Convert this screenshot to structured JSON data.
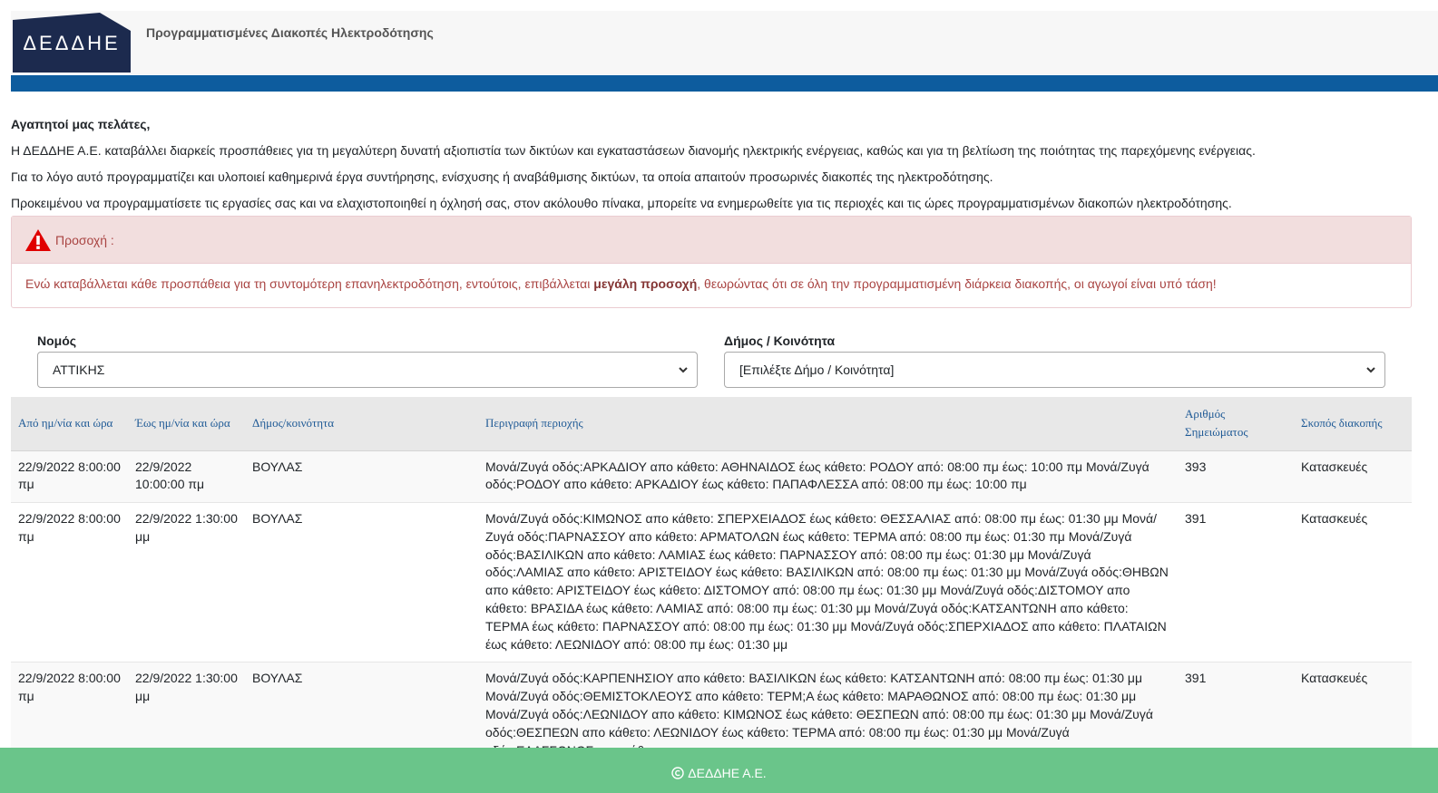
{
  "header": {
    "logo_text": "ΔΕΔΔΗΕ",
    "title": "Προγραμματισμένες Διακοπές Ηλεκτροδότησης",
    "brand_color": "#1c2a4e",
    "bar_color": "#0d5c9e"
  },
  "intro": {
    "greeting": "Αγαπητοί μας πελάτες,",
    "p1": "Η ΔΕΔΔΗΕ Α.Ε. καταβάλλει διαρκείς προσπάθειες για τη μεγαλύτερη δυνατή αξιοπιστία των δικτύων και εγκαταστάσεων διανομής ηλεκτρικής ενέργειας, καθώς και για τη βελτίωση της ποιότητας της παρεχόμενης ενέργειας.",
    "p2": "Για το λόγο αυτό προγραμματίζει και υλοποιεί καθημερινά έργα συντήρησης, ενίσχυσης ή αναβάθμισης δικτύων, τα οποία απαιτούν προσωρινές διακοπές της ηλεκτροδότησης.",
    "p3": "Προκειμένου να προγραμματίσετε τις εργασίες σας και να ελαχιστοποιηθεί η όχλησή σας, στον ακόλουθο πίνακα, μπορείτε να ενημερωθείτε για τις περιοχές και τις ώρες προγραμματισμένων διακοπών ηλεκτροδότησης."
  },
  "alert": {
    "icon": "warning-triangle-icon",
    "title": "Προσοχή :",
    "text_before": "Ενώ καταβάλλεται κάθε προσπάθεια για τη συντομότερη επανηλεκτροδότηση, εντούτοις, επιβάλλεται ",
    "text_bold": "μεγάλη προσοχή",
    "text_after": ", θεωρώντας ότι σε όλη την προγραμματισμένη διάρκεια διακοπής, οι αγωγοί είναι υπό τάση!"
  },
  "filters": {
    "prefecture_label": "Νομός",
    "prefecture_value": "ΑΤΤΙΚΗΣ",
    "municipality_label": "Δήμος / Κοινότητα",
    "municipality_value": "[Επιλέξτε Δήμο / Κοινότητα]"
  },
  "table": {
    "headers": {
      "from": "Από ημ/νία και ώρα",
      "to": "Έως ημ/νία και ώρα",
      "municipality": "Δήμος/κοινότητα",
      "area": "Περιγραφή περιοχής",
      "note_no": "Αριθμός Σημειώματος",
      "purpose": "Σκοπός διακοπής"
    },
    "rows": [
      {
        "from": "22/9/2022 8:00:00 πμ",
        "to": "22/9/2022 10:00:00 πμ",
        "municipality": "ΒΟΥΛΑΣ",
        "area": "Μονά/Ζυγά οδός:ΑΡΚΑΔΙΟΥ απο κάθετο: ΑΘΗΝΑΙΔΟΣ έως κάθετο: ΡΟΔΟΥ από: 08:00 πμ έως: 10:00 πμ Μονά/Ζυγά οδός:ΡΟΔΟΥ απο κάθετο: ΑΡΚΑΔΙΟΥ έως κάθετο: ΠΑΠΑΦΛΕΣΣΑ από: 08:00 πμ έως: 10:00 πμ",
        "note_no": "393",
        "purpose": "Κατασκευές"
      },
      {
        "from": "22/9/2022 8:00:00 πμ",
        "to": "22/9/2022 1:30:00 μμ",
        "municipality": "ΒΟΥΛΑΣ",
        "area": "Μονά/Ζυγά οδός:ΚΙΜΩΝΟΣ απο κάθετο: ΣΠΕΡΧΕΙΑΔΟΣ έως κάθετο: ΘΕΣΣΑΛΙΑΣ από: 08:00 πμ έως: 01:30 μμ Μονά/Ζυγά οδός:ΠΑΡΝΑΣΣΟΥ απο κάθετο: ΑΡΜΑΤΟΛΩΝ έως κάθετο: ΤΕΡΜΑ από: 08:00 πμ έως: 01:30 πμ Μονά/Ζυγά οδός:ΒΑΣΙΛΙΚΩΝ απο κάθετο: ΛΑΜΙΑΣ έως κάθετο: ΠΑΡΝΑΣΣΟΥ από: 08:00 πμ έως: 01:30 μμ Μονά/Ζυγά οδός:ΛΑΜΙΑΣ απο κάθετο: ΑΡΙΣΤΕΙΔΟΥ έως κάθετο: ΒΑΣΙΛΙΚΩΝ από: 08:00 πμ έως: 01:30 μμ Μονά/Ζυγά οδός:ΘΗΒΩΝ απο κάθετο: ΑΡΙΣΤΕΙΔΟΥ έως κάθετο: ΔΙΣΤΟΜΟΥ από: 08:00 πμ έως: 01:30 μμ Μονά/Ζυγά οδός:ΔΙΣΤΟΜΟΥ απο κάθετο: ΒΡΑΣΙΔΑ έως κάθετο: ΛΑΜΙΑΣ από: 08:00 πμ έως: 01:30 μμ Μονά/Ζυγά οδός:ΚΑΤΣΑΝΤΩΝΗ απο κάθετο: ΤΕΡΜΑ έως κάθετο: ΠΑΡΝΑΣΣΟΥ από: 08:00 πμ έως: 01:30 μμ Μονά/Ζυγά οδός:ΣΠΕΡΧΙΑΔΟΣ απο κάθετο: ΠΛΑΤΑΙΩΝ έως κάθετο: ΛΕΩΝΙΔΟΥ από: 08:00 πμ έως: 01:30 μμ",
        "note_no": "391",
        "purpose": "Κατασκευές"
      },
      {
        "from": "22/9/2022 8:00:00 πμ",
        "to": "22/9/2022 1:30:00 μμ",
        "municipality": "ΒΟΥΛΑΣ",
        "area": "Μονά/Ζυγά οδός:ΚΑΡΠΕΝΗΣΙΟΥ απο κάθετο: ΒΑΣΙΛΙΚΩΝ έως κάθετο: ΚΑΤΣΑΝΤΩΝΗ από: 08:00 πμ έως: 01:30 μμ Μονά/Ζυγά οδός:ΘΕΜΙΣΤΟΚΛΕΟΥΣ απο κάθετο: ΤΕΡΜ;Α έως κάθετο: ΜΑΡΑΘΩΝΟΣ από: 08:00 πμ έως: 01:30 μμ Μονά/Ζυγά οδός:ΛΕΩΝΙΔΟΥ απο κάθετο: ΚΙΜΩΝΟΣ έως κάθετο: ΘΕΣΠΕΩΝ από: 08:00 πμ έως: 01:30 μμ Μονά/Ζυγά οδός:ΘΕΣΠΕΩΝ απο κάθετο: ΛΕΩΝΙΔΟΥ έως κάθετο: ΤΕΡΜΑ από: 08:00 πμ έως: 01:30 μμ Μονά/Ζυγά οδός:ΕΛΑΣΣΩΝΟΣ απο κάθετο:",
        "note_no": "391",
        "purpose": "Κατασκευές"
      }
    ]
  },
  "footer": {
    "icon": "copyright-icon",
    "text": "ΔΕΔΔΗΕ Α.Ε."
  }
}
